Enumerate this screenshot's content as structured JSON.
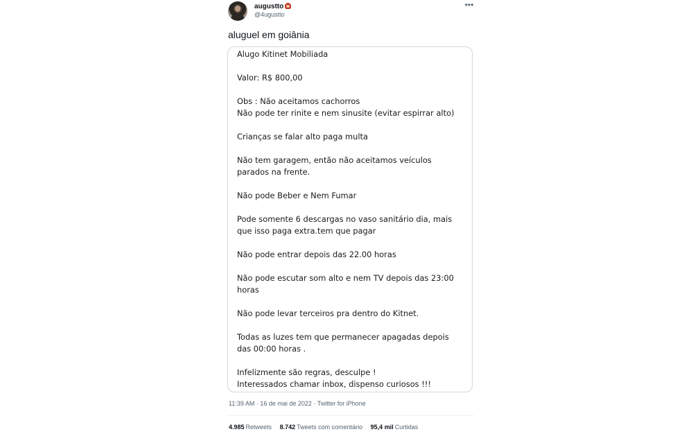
{
  "author": {
    "display_name": "augustto",
    "handle": "@4ugustto"
  },
  "tweet": {
    "text": "aluguel em goiânia",
    "timestamp": "11:39 AM · 16 de mai de 2022 · Twitter for iPhone"
  },
  "note": {
    "lines": [
      "Alugo Kitinet Mobiliada",
      "Valor: R$ 800,00",
      "Obs : Não aceitamos cachorros",
      "Não pode ter rinite e nem sinusite (evitar espirrar alto)",
      "Crianças se falar alto paga multa",
      "Não tem garagem, então não aceitamos veículos",
      "parados na frente.",
      "Não pode Beber e Nem Fumar",
      "Pode somente 6 descargas no vaso sanitário dia, mais",
      "que isso paga extra.tem que pagar",
      "Não pode entrar depois das 22.00 horas",
      "Não pode escutar som alto e nem TV depois das 23:00",
      "horas",
      "Não pode levar terceiros pra dentro do Kitnet.",
      "Todas as luzes tem que permanecer apagadas depois",
      "das 00:00 horas .",
      "Infelizmente são regras, desculpe !",
      "Interessados chamar inbox, dispenso curiosos !!!"
    ]
  },
  "stats": [
    {
      "value": "4.985",
      "label": "Retweets"
    },
    {
      "value": "8.742",
      "label": "Tweets com comentário"
    },
    {
      "value": "95,4 mil",
      "label": "Curtidas"
    }
  ],
  "icons": {
    "more": "more-horizontal-icon"
  },
  "colors": {
    "text_primary": "#0f1419",
    "text_secondary": "#536471",
    "border": "#cfd9de"
  }
}
